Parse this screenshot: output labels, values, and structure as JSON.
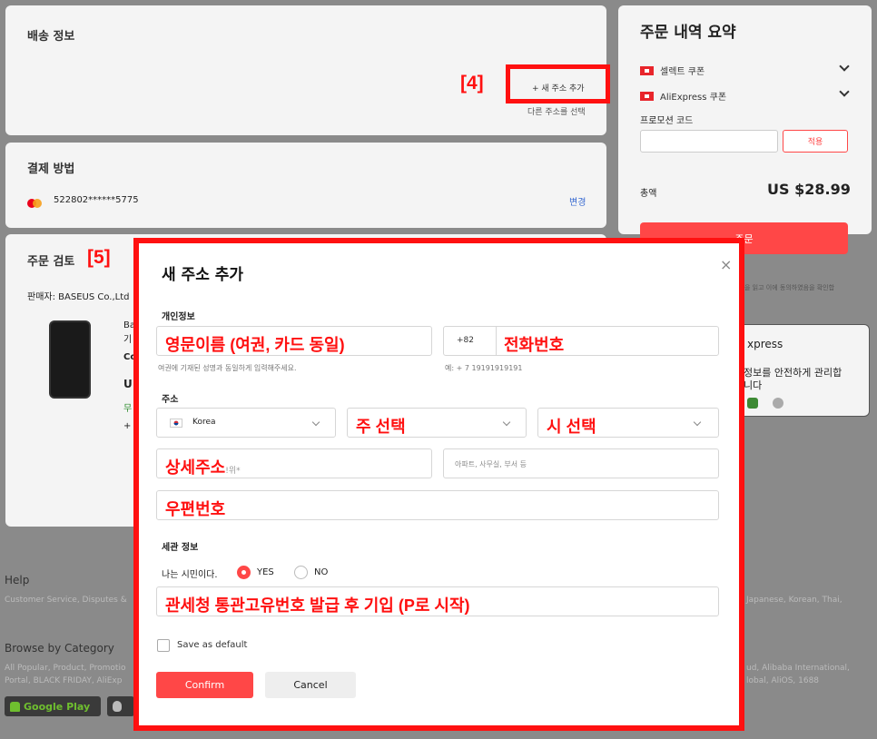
{
  "shipping": {
    "title": "배송 정보",
    "add_address": "+ 새 주소 추가",
    "select_other": "다른 주소를 선택"
  },
  "payment": {
    "title": "결제 방법",
    "card_number": "522802******5775",
    "change": "변경"
  },
  "review": {
    "title": "주문 검토",
    "seller": "판매자: BASEUS Co.,Ltd",
    "product_partial": [
      "Ba",
      "기",
      "Co",
      "U",
      "무",
      "+"
    ]
  },
  "summary": {
    "title": "주문 내역 요약",
    "select_coupon": "셀렉트 쿠폰",
    "aliexpress_coupon": "AliExpress 쿠폰",
    "promo_label": "프로모션 코드",
    "apply": "적용",
    "total_label": "총액",
    "total_value": "US $28.99",
    "order_button": "주문",
    "agree_text": "을 읽고 이에 동의하였음을 확인합",
    "brand_partial": "xpress",
    "safety_text_1": "정보를 안전하게 관리합",
    "safety_text_2": "니다"
  },
  "footer": {
    "help_title": "Help",
    "help_text": "Customer Service, Disputes &",
    "help_right": "Japanese, Korean, Thai,",
    "browse_title": "Browse by Category",
    "browse_line1": "All Popular, Product, Promotio",
    "browse_line2": "Portal, BLACK FRIDAY, AliExp",
    "browse_right1": "ud, Alibaba International,",
    "browse_right2": "lobal, AliOS, 1688",
    "google_play": "Google Play"
  },
  "annotations": {
    "label4": "[4]",
    "label5": "[5]"
  },
  "modal": {
    "title": "새 주소 추가",
    "personal_section": "개인정보",
    "name_overlay": "영문이름 (여권, 카드 동일)",
    "name_hint": "여권에 기재된 성명과 동일하게 입력해주세요.",
    "phone_code": "+82",
    "phone_overlay": "전화번호",
    "phone_hint": "예: + 7 19191919191",
    "address_section": "주소",
    "country": "Korea",
    "state_overlay": "주 선택",
    "city_overlay": "시 선택",
    "detail_overlay": "상세주소",
    "detail_ph_tail": "!위*",
    "apt_placeholder": "아파트, 사무실, 부서 등",
    "zip_overlay": "우편번호",
    "customs_section": "세관 정보",
    "citizen_question": "나는 시민이다.",
    "yes": "YES",
    "no": "NO",
    "customs_overlay": "관세청 통관고유번호 발급 후 기입 (P로 시작)",
    "save_default": "Save as default",
    "confirm": "Confirm",
    "cancel": "Cancel",
    "close_symbol": "×"
  },
  "colors": {
    "accent": "#ff4747",
    "annotation": "#ff1010",
    "overlay": "#8a8a8a"
  }
}
